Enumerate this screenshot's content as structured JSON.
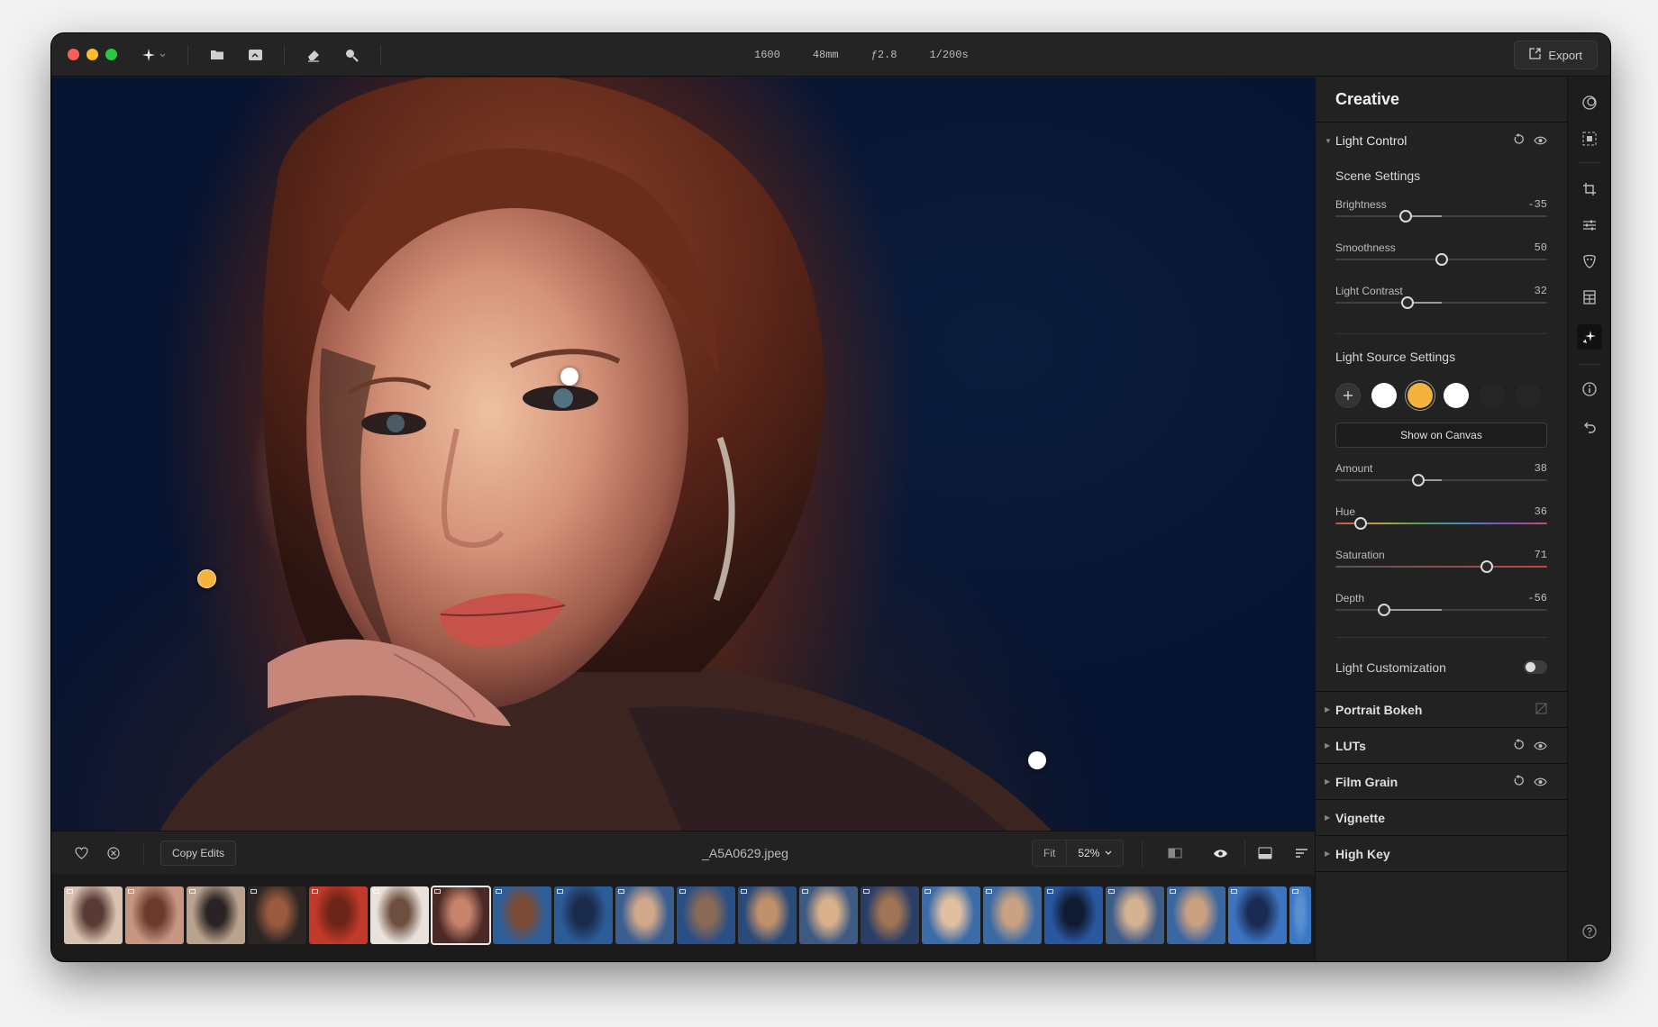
{
  "exif": {
    "iso": "1600",
    "focal": "48mm",
    "aperture": "ƒ2.8",
    "shutter": "1/200s"
  },
  "toolbar": {
    "export_label": "Export"
  },
  "canvas": {
    "photo_name": "_A5A0629.jpeg",
    "light_points": [
      {
        "color": "#ffffff"
      },
      {
        "color": "#f3b33e"
      },
      {
        "color": "#ffffff"
      }
    ]
  },
  "bottombar": {
    "copy_edits_label": "Copy Edits",
    "fit_label": "Fit",
    "zoom_label": "52%"
  },
  "filmstrip": {
    "count": 21,
    "selected_index": 6
  },
  "panel": {
    "title": "Creative",
    "light_control": {
      "title": "Light Control",
      "scene_settings_title": "Scene Settings",
      "scene_sliders": [
        {
          "label": "Brightness",
          "value": "-35",
          "pos": 0.33
        },
        {
          "label": "Smoothness",
          "value": "50",
          "pos": 0.5
        },
        {
          "label": "Light Contrast",
          "value": "32",
          "pos": 0.34
        }
      ],
      "light_source_title": "Light Source Settings",
      "show_on_canvas_label": "Show on Canvas",
      "source_sliders": [
        {
          "label": "Amount",
          "value": "38",
          "pos": 0.39
        },
        {
          "label": "Hue",
          "value": "36",
          "pos": 0.12
        },
        {
          "label": "Saturation",
          "value": "71",
          "pos": 0.71
        },
        {
          "label": "Depth",
          "value": "-56",
          "pos": 0.23
        }
      ],
      "customization_label": "Light Customization",
      "customization_on": false
    },
    "collapsed_sections": [
      {
        "title": "Portrait Bokeh"
      },
      {
        "title": "LUTs"
      },
      {
        "title": "Film Grain"
      },
      {
        "title": "Vignette"
      },
      {
        "title": "High Key"
      }
    ]
  },
  "colors": {
    "accent": "#f3b33e",
    "close": "#ff5f57",
    "minimize": "#febc2e",
    "zoom": "#28c840"
  }
}
